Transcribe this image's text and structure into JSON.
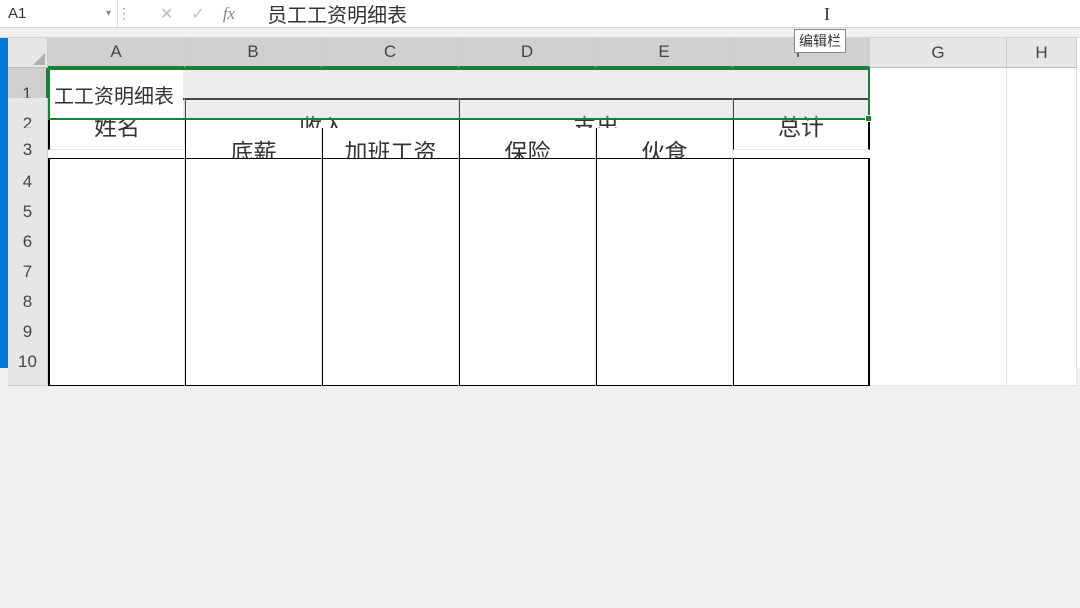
{
  "formula_bar": {
    "name_box": "A1",
    "cancel_icon": "✕",
    "enter_icon": "✓",
    "fx_icon": "fx",
    "formula_text": "员工工资明细表",
    "tooltip": "编辑栏"
  },
  "columns": [
    "A",
    "B",
    "C",
    "D",
    "E",
    "F",
    "G",
    "H"
  ],
  "rows": [
    "1",
    "2",
    "3",
    "4",
    "5",
    "6",
    "7",
    "8",
    "9",
    "10"
  ],
  "table": {
    "title": "员工工资明细表",
    "title_display": "工工资明细表",
    "header_name": "姓名",
    "header_income": "收入",
    "header_expense": "支出",
    "header_total": "总计",
    "sub_base": "底薪",
    "sub_overtime": "加班工资",
    "sub_insurance": "保险",
    "sub_meal": "伙食"
  }
}
